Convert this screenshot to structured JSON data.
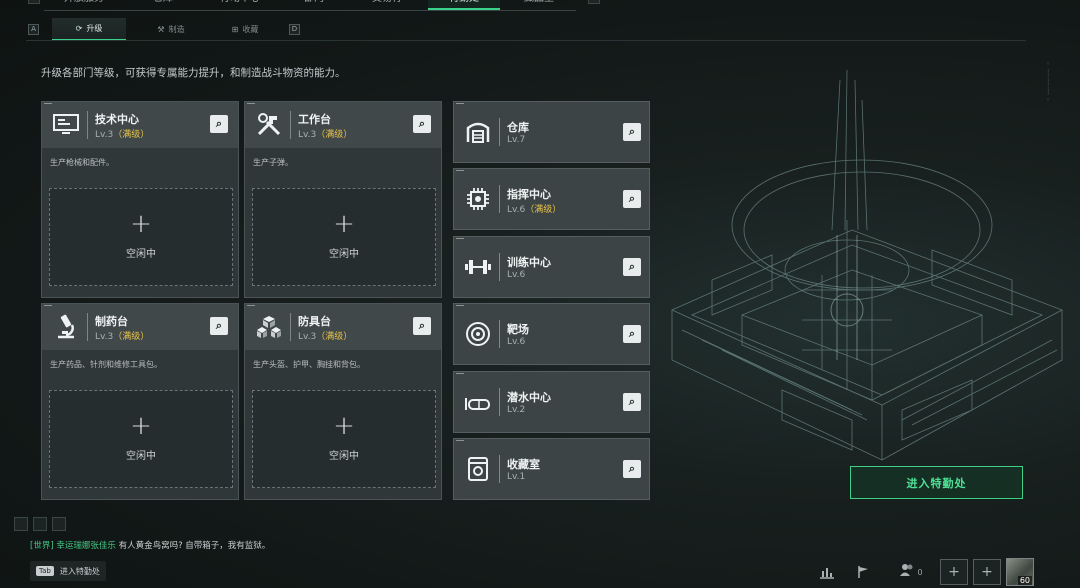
{
  "top_nav": {
    "tabs": [
      {
        "label": "开放服务",
        "active": false
      },
      {
        "label": "仓库",
        "active": false
      },
      {
        "label": "行动中心",
        "active": false
      },
      {
        "label": "部门",
        "active": false
      },
      {
        "label": "交易行",
        "active": false
      },
      {
        "label": "特勤处",
        "active": true
      },
      {
        "label": "藏品室",
        "active": false
      }
    ]
  },
  "sub_tabs": {
    "left_key": "A",
    "right_key": "D",
    "items": [
      {
        "label": "升级",
        "icon": "upgrade-icon",
        "active": true
      },
      {
        "label": "制造",
        "icon": "craft-icon",
        "active": false
      },
      {
        "label": "收藏",
        "icon": "collect-icon",
        "active": false
      }
    ]
  },
  "description": "升级各部门等级，可获得专属能力提升，和制造战斗物资的能力。",
  "big_cards": [
    {
      "name": "技术中心",
      "level": "Lv.3",
      "max_label": "（满级）",
      "icon": "computer-icon",
      "desc": "生产枪械和配件。",
      "plus": "+",
      "status": "空闲中"
    },
    {
      "name": "工作台",
      "level": "Lv.3",
      "max_label": "（满级）",
      "icon": "tools-icon",
      "desc": "生产子弹。",
      "plus": "+",
      "status": "空闲中"
    },
    {
      "name": "制药台",
      "level": "Lv.3",
      "max_label": "（满级）",
      "icon": "microscope-icon",
      "desc": "生产药品、针剂和维修工具包。",
      "plus": "+",
      "status": "空闲中"
    },
    {
      "name": "防具台",
      "level": "Lv.3",
      "max_label": "（满级）",
      "icon": "cubes-icon",
      "desc": "生产头盔、护甲、胸挂和背包。",
      "plus": "+",
      "status": "空闲中"
    }
  ],
  "small_cards": [
    {
      "name": "仓库",
      "level": "Lv.7",
      "max_label": "",
      "icon": "warehouse-icon"
    },
    {
      "name": "指挥中心",
      "level": "Lv.6",
      "max_label": "（满级）",
      "icon": "chip-icon"
    },
    {
      "name": "训练中心",
      "level": "Lv.6",
      "max_label": "",
      "icon": "dumbbell-icon"
    },
    {
      "name": "靶场",
      "level": "Lv.6",
      "max_label": "",
      "icon": "target-icon"
    },
    {
      "name": "潜水中心",
      "level": "Lv.2",
      "max_label": "",
      "icon": "diving-mask-icon"
    },
    {
      "name": "收藏室",
      "level": "Lv.1",
      "max_label": "",
      "icon": "trophy-case-icon"
    }
  ],
  "enter_button": "进入特勤处",
  "chat": {
    "channel": "[世界]",
    "user": "幸运瑞娜张佳乐",
    "message": "有人黄金鸟窝吗? 自带箱子，我有监狱。"
  },
  "bottom": {
    "tab_key": "Tab",
    "tab_label": "进入特勤处",
    "friend_count": "0",
    "player_level": "60"
  },
  "colors": {
    "accent_green": "#3ad28b",
    "max_gold": "#e8c24a"
  }
}
